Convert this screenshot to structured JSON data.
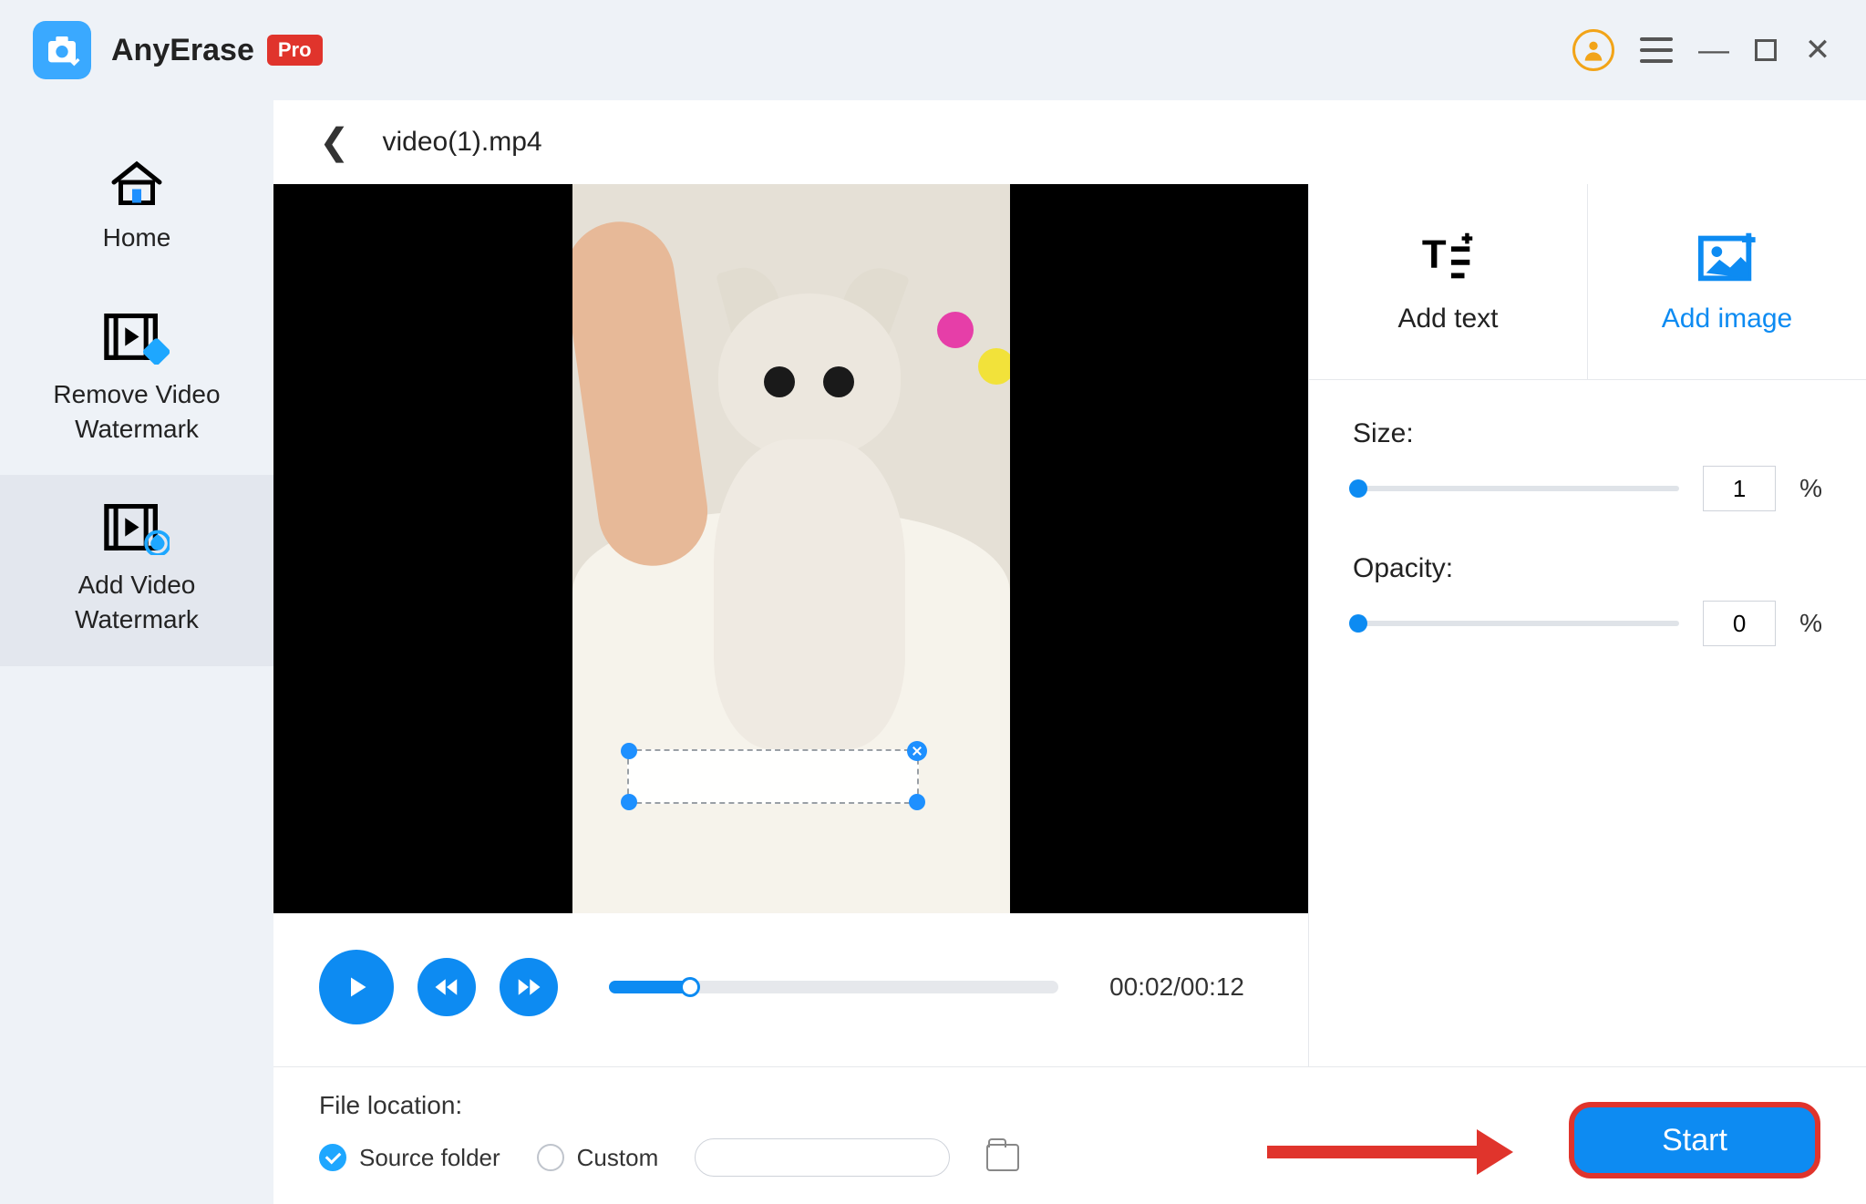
{
  "app": {
    "name": "AnyErase",
    "badge": "Pro"
  },
  "nav": {
    "home": "Home",
    "remove": "Remove Video\nWatermark",
    "add": "Add Video\nWatermark"
  },
  "file": {
    "name": "video(1).mp4"
  },
  "playback": {
    "time": "00:02/00:12"
  },
  "filelocation": {
    "title": "File location:",
    "source": "Source folder",
    "custom": "Custom"
  },
  "start": {
    "label": "Start"
  },
  "tabs": {
    "text": "Add text",
    "image": "Add image"
  },
  "controls": {
    "size_label": "Size:",
    "size_value": "1",
    "opacity_label": "Opacity:",
    "opacity_value": "0",
    "pct": "%"
  }
}
